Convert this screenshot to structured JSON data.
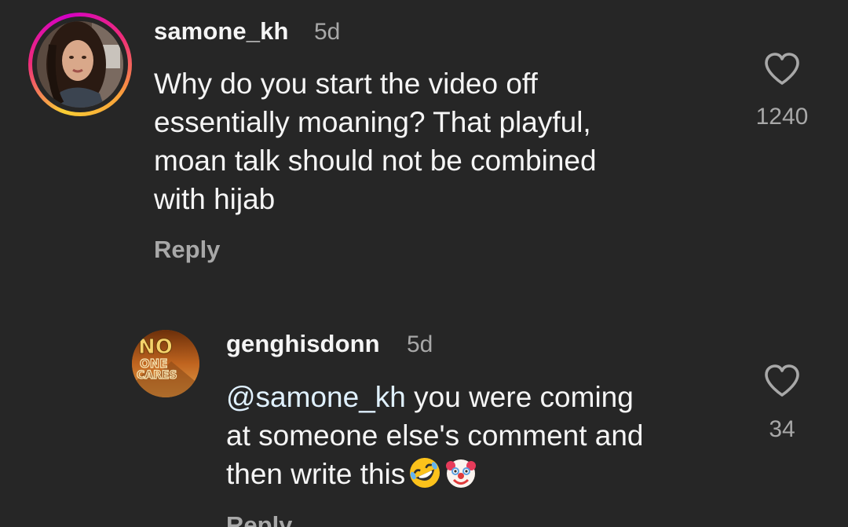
{
  "comments": [
    {
      "username": "samone_kh",
      "time": "5d",
      "text": "Why do you start the video off essentially moaning? That playful, moan talk should not be combined with hijab",
      "lines": [
        "Why do you start the video off",
        "essentially moaning? That playful,",
        "moan talk should not be combined",
        "with hijab"
      ],
      "likes": "1240",
      "reply_label": "Reply",
      "avatar_icon": "profile-photo"
    },
    {
      "username": "genghisdonn",
      "time": "5d",
      "mention": "@samone_kh",
      "lines": [
        " you were coming",
        "at someone else's comment and",
        "then write this"
      ],
      "emojis": [
        "rolling-on-floor-laughing-emoji",
        "clown-face-emoji"
      ],
      "likes": "34",
      "reply_label": "Reply",
      "avatar_text": [
        "NO",
        "ONE",
        "CARES"
      ]
    }
  ],
  "icons": {
    "like": "heart-outline-icon"
  },
  "colors": {
    "background": "#262626",
    "text_primary": "#f5f5f5",
    "text_secondary": "#a8a8a8",
    "mention": "#e0f1ff",
    "story_ring_start": "#f9ce34",
    "story_ring_mid": "#ee2a7b",
    "avatar2_bg": "#a3561b"
  }
}
